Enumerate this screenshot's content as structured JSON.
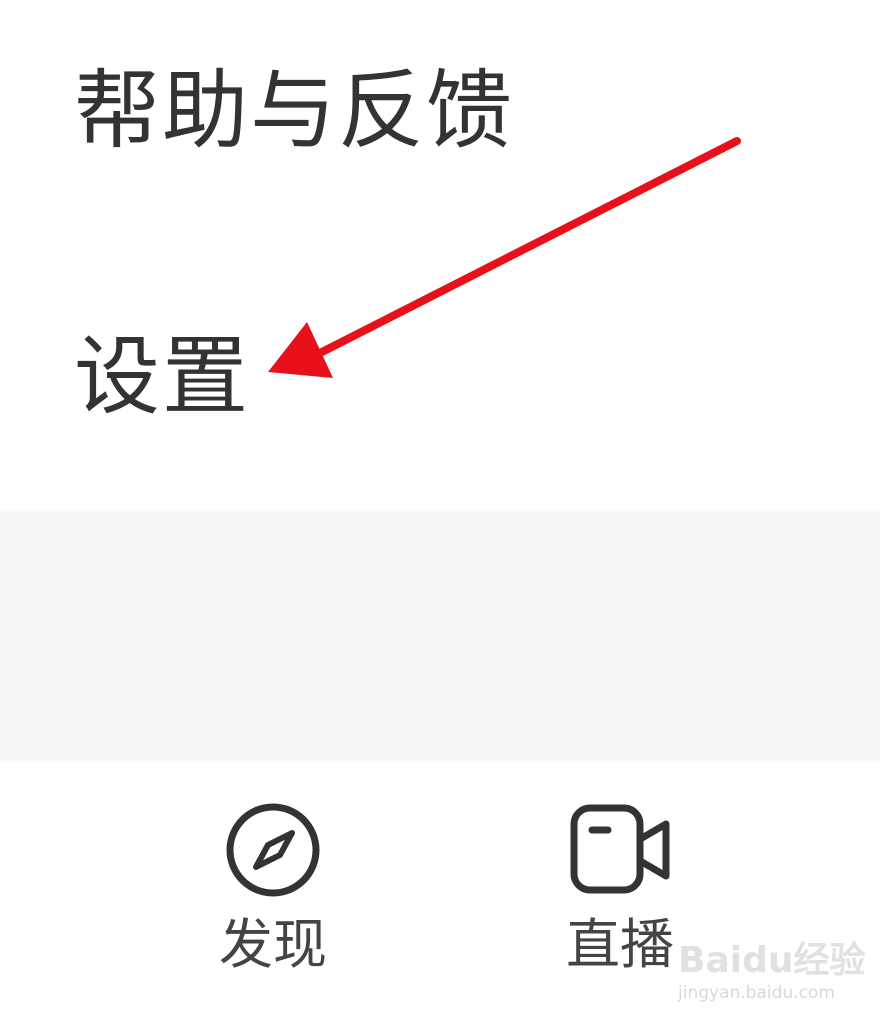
{
  "menu": {
    "items": [
      {
        "label": "帮助与反馈"
      },
      {
        "label": "设置"
      }
    ]
  },
  "bottom_nav": {
    "tabs": [
      {
        "label": "发现",
        "icon": "compass-icon"
      },
      {
        "label": "直播",
        "icon": "video-camera-icon"
      }
    ]
  },
  "annotation": {
    "arrow_color": "#e8101a"
  },
  "watermark": {
    "brand": "Baidu经验",
    "url": "jingyan.baidu.com"
  },
  "colors": {
    "background": "#ffffff",
    "band": "#f8f8fb",
    "text": "#333333",
    "icon_stroke": "#333333"
  }
}
